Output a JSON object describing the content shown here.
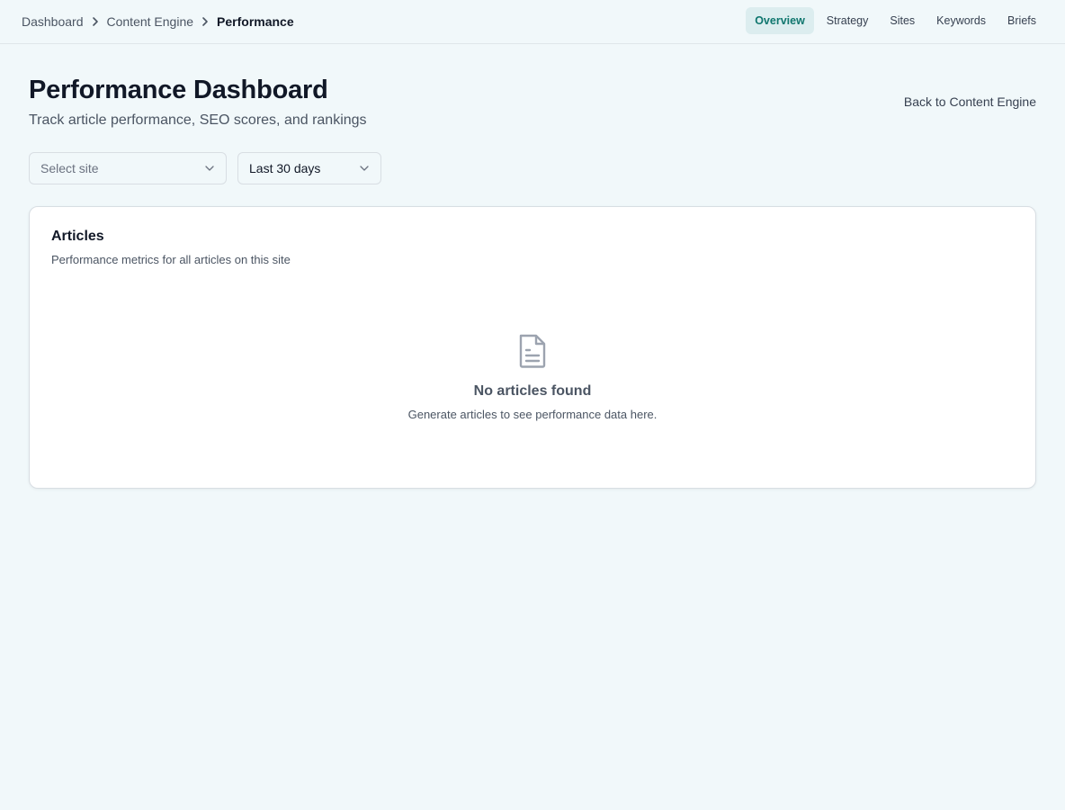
{
  "breadcrumb": {
    "items": [
      "Dashboard",
      "Content Engine"
    ],
    "current": "Performance"
  },
  "nav": {
    "items": [
      "Overview",
      "Strategy",
      "Sites",
      "Keywords",
      "Briefs"
    ],
    "active": "Overview"
  },
  "header": {
    "title": "Performance Dashboard",
    "subtitle": "Track article performance, SEO scores, and rankings",
    "back_link": "Back to Content Engine"
  },
  "filters": {
    "site_select": {
      "placeholder": "Select site"
    },
    "range_select": {
      "value": "Last 30 days"
    }
  },
  "articles_card": {
    "title": "Articles",
    "description": "Performance metrics for all articles on this site",
    "empty_state": {
      "icon": "document-icon",
      "title": "No articles found",
      "message": "Generate articles to see performance data here."
    }
  },
  "colors": {
    "background": "#f1f8fa",
    "accent": "#0f766e",
    "active_nav_bg": "#dcedef",
    "card_bg": "#ffffff"
  }
}
